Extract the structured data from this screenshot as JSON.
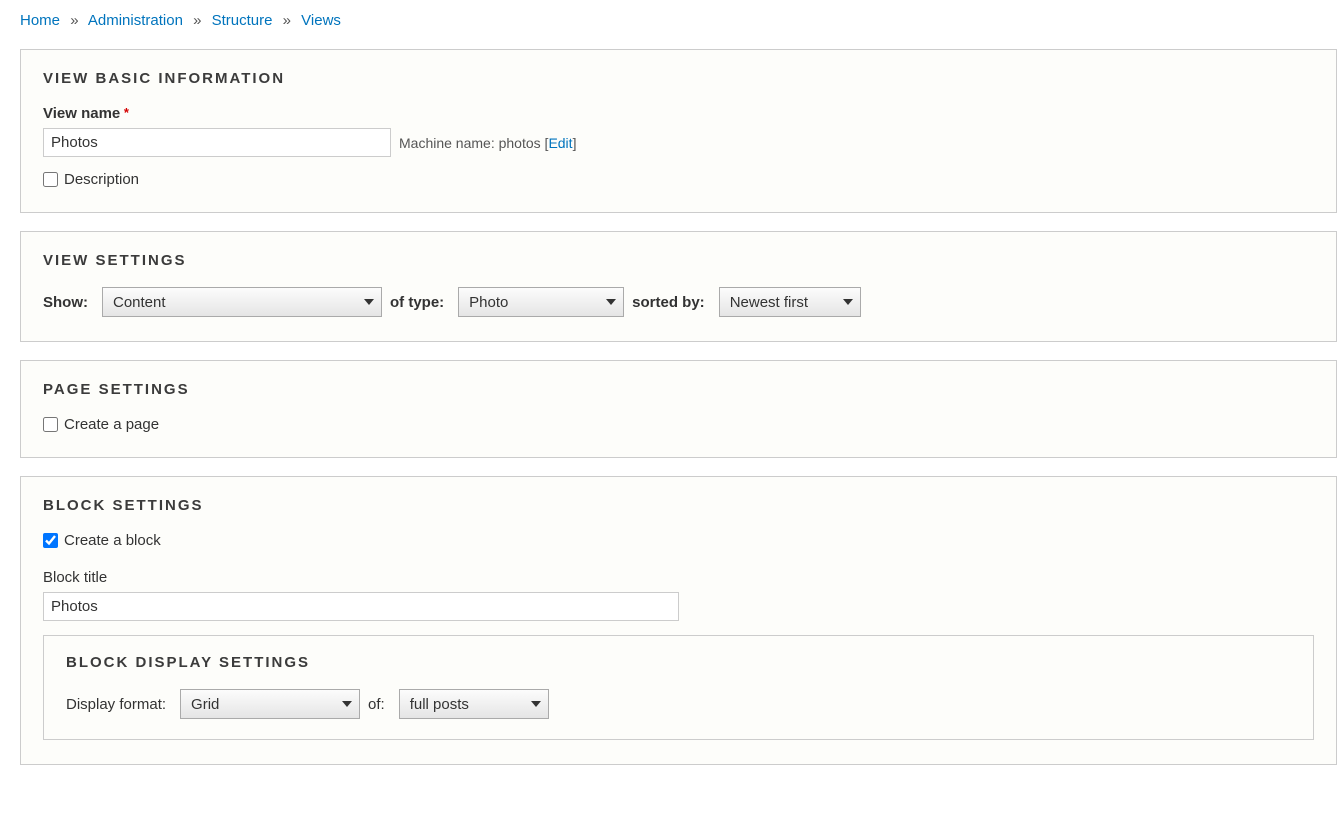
{
  "breadcrumb": {
    "items": [
      "Home",
      "Administration",
      "Structure",
      "Views"
    ]
  },
  "sections": {
    "basic": {
      "legend": "VIEW BASIC INFORMATION",
      "viewNameLabel": "View name",
      "viewNameValue": "Photos",
      "machineNameLabel": "Machine name:",
      "machineNameValue": "photos",
      "editLink": "Edit",
      "descriptionLabel": "Description"
    },
    "viewSettings": {
      "legend": "VIEW SETTINGS",
      "showLabel": "Show:",
      "showValue": "Content",
      "ofTypeLabel": "of type:",
      "ofTypeValue": "Photo",
      "sortedByLabel": "sorted by:",
      "sortedByValue": "Newest first"
    },
    "pageSettings": {
      "legend": "PAGE SETTINGS",
      "createPageLabel": "Create a page"
    },
    "blockSettings": {
      "legend": "BLOCK SETTINGS",
      "createBlockLabel": "Create a block",
      "blockTitleLabel": "Block title",
      "blockTitleValue": "Photos",
      "displaySettings": {
        "legend": "BLOCK DISPLAY SETTINGS",
        "displayFormatLabel": "Display format:",
        "displayFormatValue": "Grid",
        "ofLabel": "of:",
        "ofValue": "full posts"
      }
    }
  }
}
